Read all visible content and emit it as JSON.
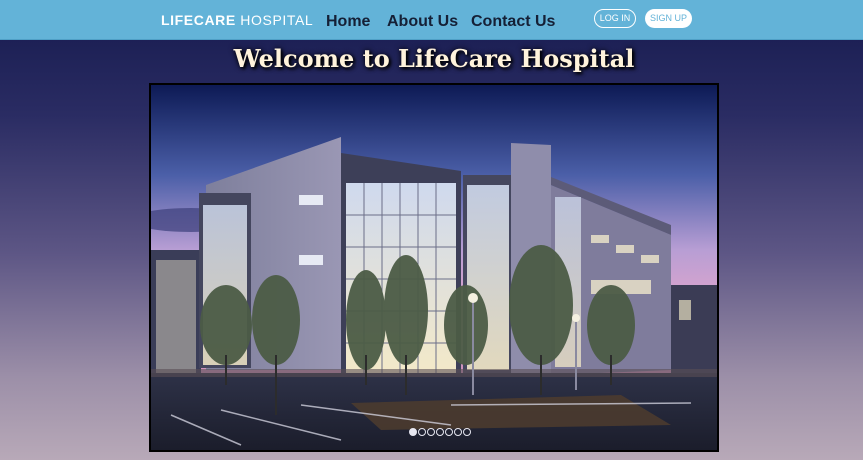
{
  "header": {
    "logo_bold": "LIFECARE",
    "logo_rest": " HOSPITAL",
    "nav": [
      {
        "label": "Home"
      },
      {
        "label": "About Us"
      },
      {
        "label": "Contact Us"
      }
    ],
    "login_label": "LOG IN",
    "signup_label": "SIGN UP"
  },
  "main": {
    "title": "Welcome to LifeCare Hospital"
  },
  "slider": {
    "slide_count": 7,
    "active_index": 0
  },
  "colors": {
    "navbar": "#63b3d8",
    "nav_text": "#152036",
    "title_text": "#fff3dc"
  }
}
